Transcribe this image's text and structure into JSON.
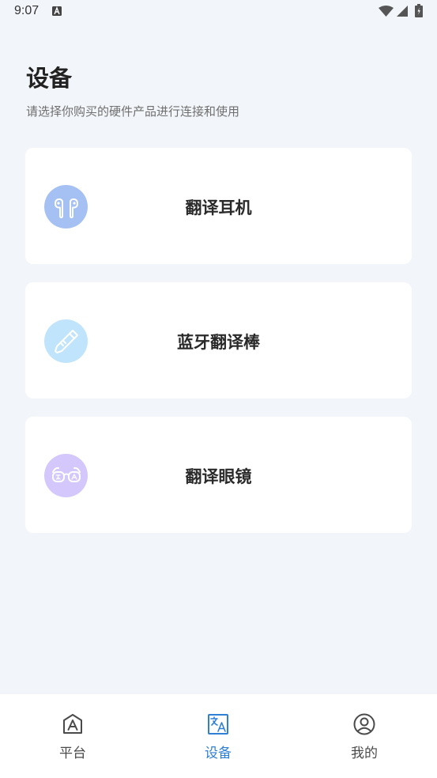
{
  "status_bar": {
    "time": "9:07"
  },
  "header": {
    "title": "设备",
    "subtitle": "请选择你购买的硬件产品进行连接和使用"
  },
  "devices": [
    {
      "label": "翻译耳机",
      "icon": "earbuds-icon",
      "icon_bg": "#a5c0f2"
    },
    {
      "label": "蓝牙翻译棒",
      "icon": "translator-pen-icon",
      "icon_bg": "#bfe4fb"
    },
    {
      "label": "翻译眼镜",
      "icon": "glasses-icon",
      "icon_bg": "#d4c7fb"
    }
  ],
  "bottom_nav": {
    "items": [
      {
        "label": "平台",
        "icon": "platform-icon",
        "active": false
      },
      {
        "label": "设备",
        "icon": "translate-device-icon",
        "active": true
      },
      {
        "label": "我的",
        "icon": "profile-icon",
        "active": false
      }
    ],
    "active_color": "#2f7fd6"
  }
}
